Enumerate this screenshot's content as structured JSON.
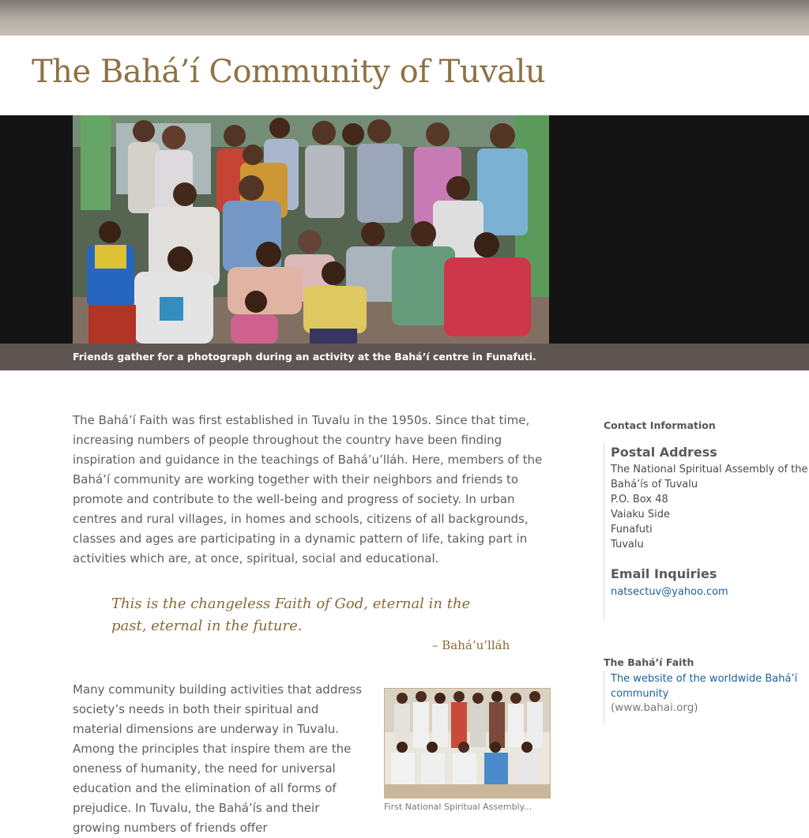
{
  "header": {
    "site_title": "The Bahá’í Community of Tuvalu"
  },
  "hero": {
    "caption": "Friends gather for a photograph during an activity at the Bahá’í centre in Funafuti."
  },
  "main": {
    "paragraph_1": "The Bahá’í Faith was first established in Tuvalu in the 1950s. Since that time, increasing numbers of people throughout the country have been finding inspiration and guidance in the teachings of Bahá’u’lláh. Here, members of the Bahá’í community are working together with their neighbors and friends to promote and contribute to the well-being and progress of society. In urban centres and rural villages, in homes and schools, citizens of all backgrounds, classes and ages are participating in a dynamic pattern of life, taking part in activities which are, at once, spiritual, social and educational.",
    "quote_text": "This is the changeless Faith of God, eternal in the past, eternal in the future.",
    "quote_attribution": "– Bahá’u’lláh",
    "paragraph_2": "Many community building activities that address society’s needs in both their spiritual and material dimensions are underway in Tuvalu. Among the principles that inspire them are the oneness of humanity, the need for universal education and the elimination of all forms of prejudice. In Tuvalu, the Bahá’ís and their growing numbers of friends offer",
    "thumbnail_caption": "First National Spiritual Assembly..."
  },
  "sidebar": {
    "contact_heading": "Contact Information",
    "postal_heading": "Postal Address",
    "address_lines": [
      "The National Spiritual Assembly of the",
      "Bahá’ís of Tuvalu",
      "P.O. Box 48",
      "Vaiaku Side",
      "Funafuti",
      "Tuvalu"
    ],
    "email_heading": "Email Inquiries",
    "email": "natsectuv@yahoo.com",
    "faith_heading": "The Bahá’í Faith",
    "faith_link": "The website of the worldwide Bahá’í community",
    "faith_url": "(www.bahai.org)"
  },
  "colors": {
    "title": "#8f7244",
    "quote": "#8a6a35",
    "link": "#1f5f98",
    "caption_bar": "#5e5553"
  }
}
